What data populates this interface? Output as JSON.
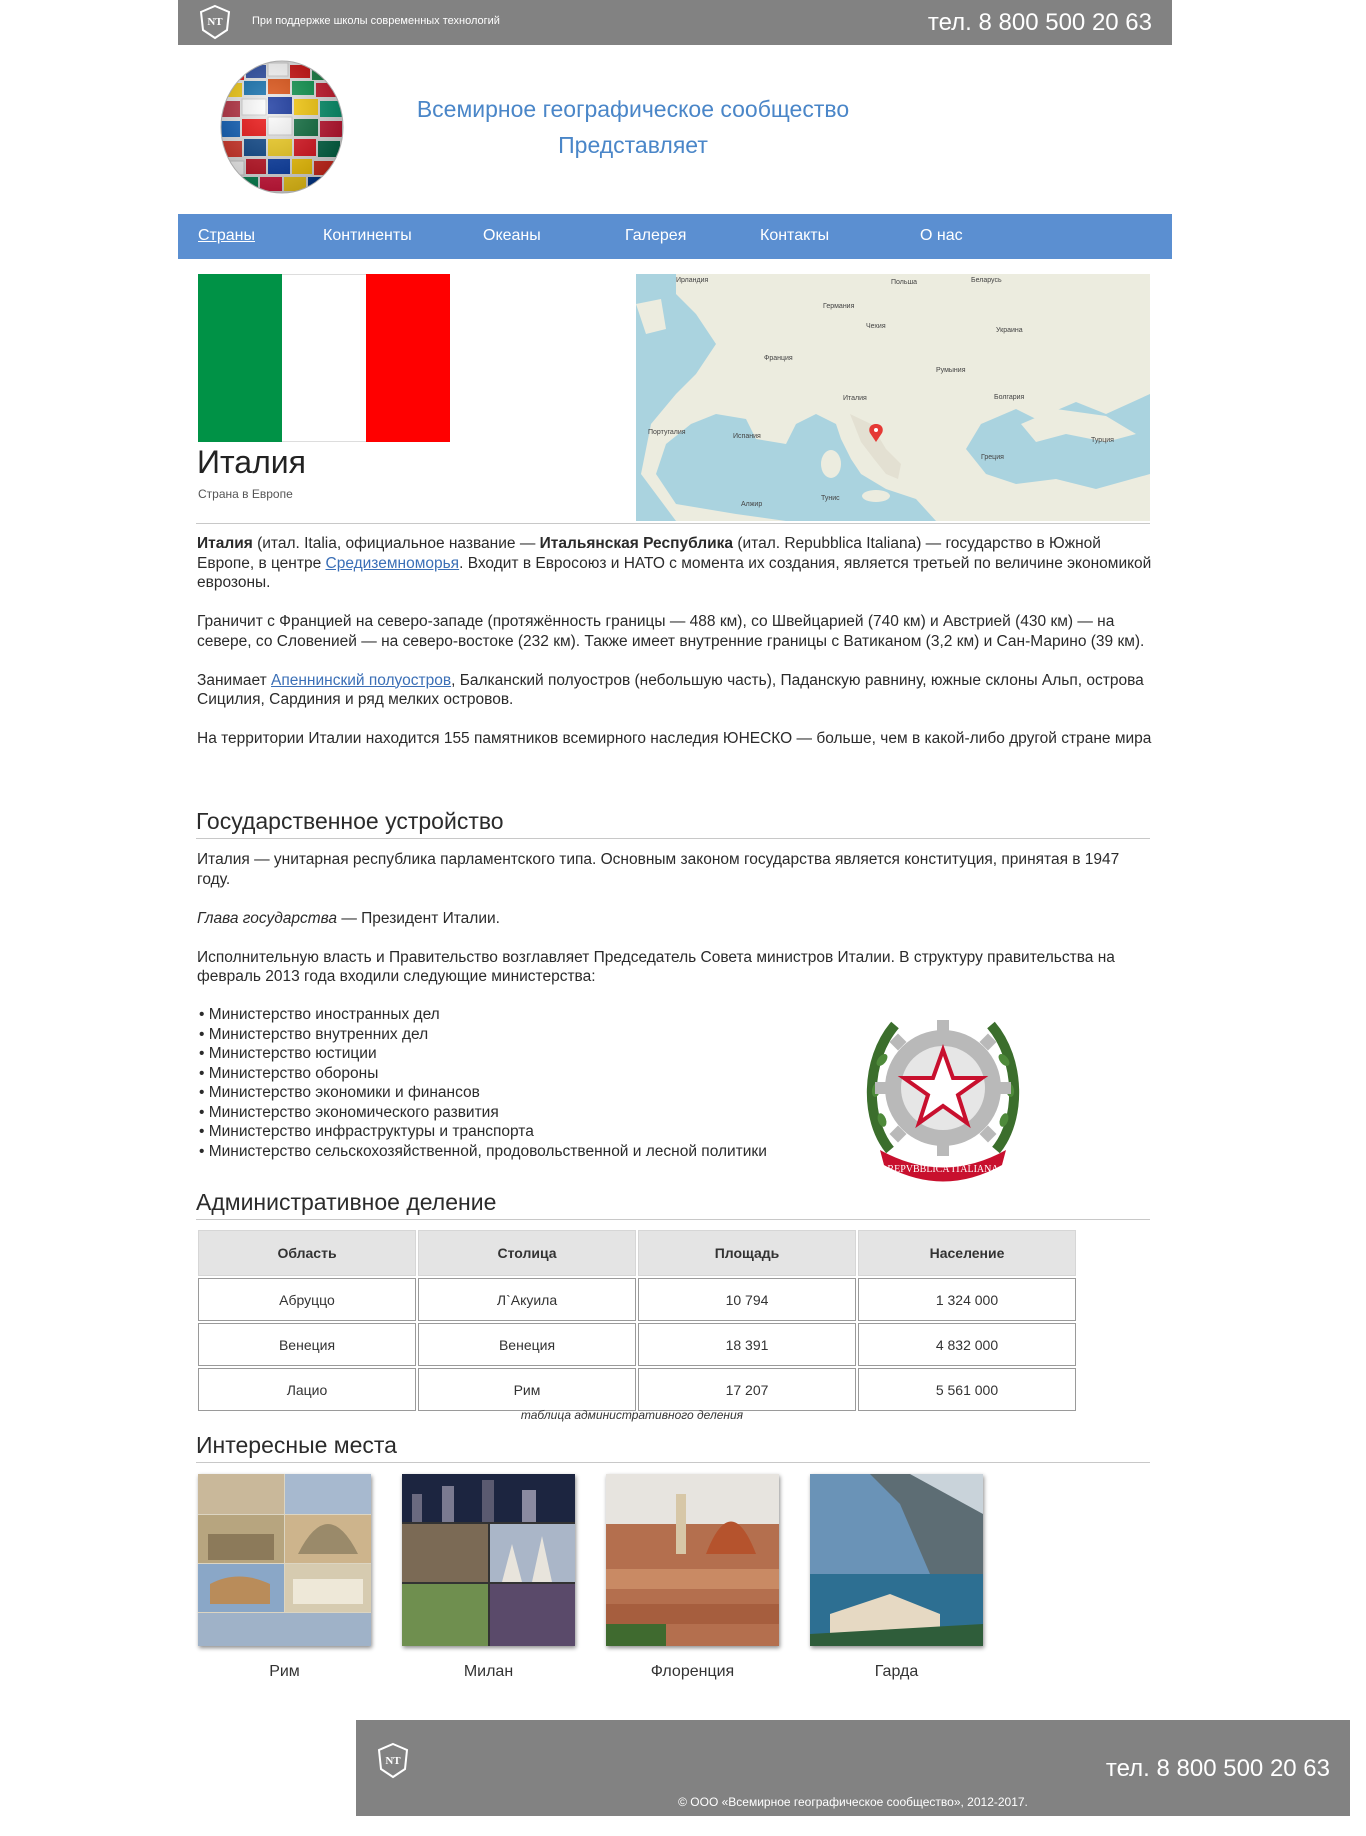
{
  "topbar": {
    "slogan": "При поддержке школы современных технологий",
    "phone": "тел. 8 800 500 20 63",
    "logo_text": "NT"
  },
  "header": {
    "title_line1": "Всемирное географическое сообщество",
    "title_line2": "Представляет"
  },
  "nav": {
    "items": [
      {
        "label": "Страны",
        "active": true
      },
      {
        "label": "Континенты"
      },
      {
        "label": "Океаны"
      },
      {
        "label": "Галерея"
      },
      {
        "label": "Контакты"
      },
      {
        "label": "О нас"
      }
    ]
  },
  "country": {
    "name": "Италия",
    "subtitle": "Страна в Европе",
    "flag_colors": [
      "#009246",
      "#ffffff",
      "#ff0000"
    ]
  },
  "map": {
    "labels": [
      "Ирландия",
      "Польша",
      "Беларусь",
      "Германия",
      "Украина",
      "Франция",
      "Румыния",
      "Италия",
      "Португалия",
      "Испания",
      "Турция",
      "Алжир",
      "Тунис",
      "Греция",
      "Болгария",
      "Чехия"
    ]
  },
  "intro": {
    "p1_bold1": "Италия",
    "p1_t1": " (итал. Italia, официальное название — ",
    "p1_bold2": "Итальянская Республика",
    "p1_t2": " (итал. Repubblica Italiana) — государство в Южной Европе, в центре ",
    "p1_link": "Средиземноморья",
    "p1_t3": ". Входит в Евросоюз и НАТО с момента их создания, является третьей по величине экономикой еврозоны.",
    "p2": "Граничит с Францией на северо-западе (протяжённость границы — 488 км), со Швейцарией (740 км) и Австрией (430 км) — на севере, со Словенией — на северо-востоке (232 км). Также имеет внутренние границы с Ватиканом (3,2 км) и Сан-Марино (39 км).",
    "p3_t1": "Занимает ",
    "p3_link": "Апеннинский полуостров",
    "p3_t2": ", Балканский полуостров (небольшую часть), Паданскую равнину, южные склоны Альп, острова Сицилия, Сардиния и ряд мелких островов.",
    "p4": "На территории Италии находится 155 памятников всемирного наследия ЮНЕСКО — больше, чем в какой-либо другой стране мира"
  },
  "government": {
    "heading": "Государственное устройство",
    "p1": "Италия — унитарная республика парламентского типа. Основным законом государства является конституция, принятая в 1947 году.",
    "p2_italic": "Глава государства",
    "p2_rest": " — Президент Италии.",
    "p3": "Исполнительную власть и Правительство возглавляет Председатель Совета министров Италии. В структуру правительства на февраль 2013 года входили следующие министерства:",
    "ministries": [
      "Министерство иностранных дел",
      "Министерство внутренних дел",
      "Министерство юстиции",
      "Министерство обороны",
      "Министерство экономики и финансов",
      "Министерство экономического развития",
      "Министерство инфраструктуры и транспорта",
      "Министерство сельскохозяйственной, продовольственной и лесной политики"
    ],
    "emblem_text": "REPVBBLICA ITALIANA"
  },
  "admin": {
    "heading": "Административное деление",
    "headers": [
      "Область",
      "Столица",
      "Площадь",
      "Население"
    ],
    "rows": [
      [
        "Абруццо",
        "Л`Акуила",
        "10 794",
        "1 324 000"
      ],
      [
        "Венеция",
        "Венеция",
        "18 391",
        "4 832 000"
      ],
      [
        "Лацио",
        "Рим",
        "17 207",
        "5 561 000"
      ]
    ],
    "caption": "таблица административного деления"
  },
  "places": {
    "heading": "Интересные места",
    "items": [
      {
        "name": "Рим"
      },
      {
        "name": "Милан"
      },
      {
        "name": "Флоренция"
      },
      {
        "name": "Гарда"
      }
    ]
  },
  "footer": {
    "phone": "тел. 8 800 500 20 63",
    "copyright": "© ООО «Всемирное географическое сообщество», 2012-2017."
  }
}
